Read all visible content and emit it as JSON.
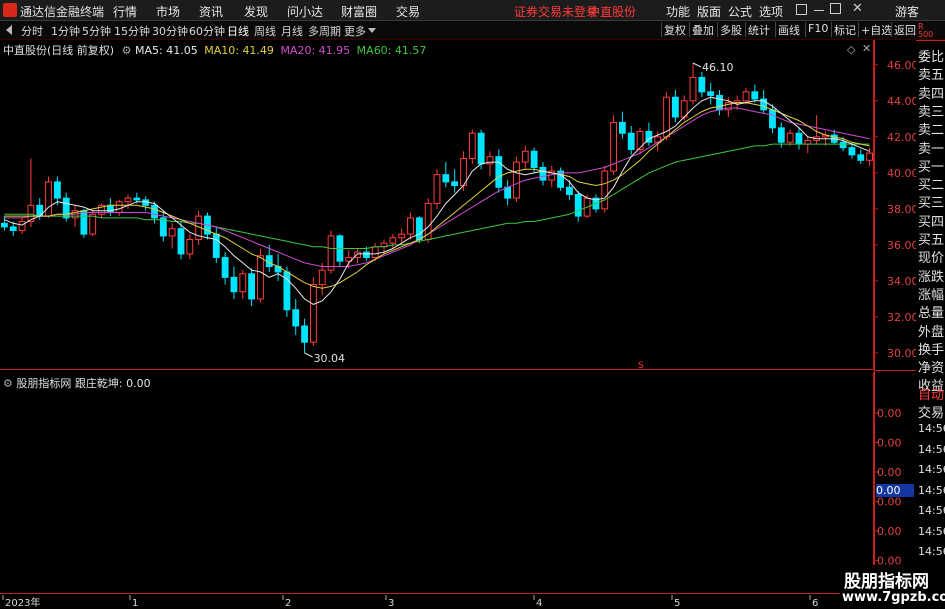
{
  "window": {
    "app_title": "通达信金融终端",
    "menus": [
      "行情",
      "市场",
      "资讯",
      "发现",
      "问小达",
      "财富圈",
      "交易"
    ],
    "status": "证券交易未登录",
    "stock": "中直股份",
    "right_menus": [
      "功能",
      "版面",
      "公式",
      "选项"
    ],
    "guest": "游客"
  },
  "toolbar": {
    "periods": [
      "分时",
      "1分钟",
      "5分钟",
      "15分钟",
      "30分钟",
      "60分钟",
      "日线",
      "周线",
      "月线",
      "多周期",
      "更多"
    ],
    "active_period": "日线",
    "right_buttons": [
      "复权",
      "叠加",
      "多股",
      "统计",
      "画线",
      "F10",
      "标记",
      "+自选",
      "返回"
    ]
  },
  "main_chart": {
    "title": "中直股份(日线 前复权)",
    "ma": [
      {
        "name": "MA5",
        "value": "41.05",
        "color": "#e8e8e8"
      },
      {
        "name": "MA10",
        "value": "41.49",
        "color": "#e0d23c"
      },
      {
        "name": "MA20",
        "value": "41.95",
        "color": "#d14bd1"
      },
      {
        "name": "MA60",
        "value": "41.57",
        "color": "#3cc83c"
      }
    ],
    "high_label": "46.10",
    "low_label": "30.04",
    "marker": "S"
  },
  "sub_chart": {
    "indicator": "股朋指标网",
    "line_name": "跟庄乾坤",
    "line_value": "0.00",
    "current_value": "0.00"
  },
  "side_panel": {
    "header_top": "R",
    "header_bottom": "500",
    "items": [
      "委比",
      "卖五",
      "卖四",
      "卖三",
      "卖二",
      "卖一",
      "买一",
      "买二",
      "买三",
      "买四",
      "买五",
      "现价",
      "涨跌",
      "涨幅",
      "总量",
      "外盘",
      "换手",
      "净资",
      "收益"
    ],
    "auto_label": "自动",
    "trade_label": "交易",
    "times": [
      "14:56",
      "14:56",
      "14:56",
      "14:56",
      "14:56",
      "14:56",
      "14:56",
      "14:56",
      "14:56"
    ]
  },
  "watermark": {
    "line1": "股朋指标网",
    "line2": "www.7gpzb.com"
  },
  "colors": {
    "up": "#ff3c3c",
    "down": "#00e5ff",
    "axis": "#c82020"
  },
  "chart_data": {
    "type": "candlestick",
    "ylim": [
      29.5,
      46.6
    ],
    "yticks": [
      30,
      32,
      34,
      36,
      38,
      40,
      42,
      44,
      46
    ],
    "sub_yticks": [
      "0.00",
      "0.00",
      "0.00",
      "0.00",
      "0.00",
      "0.00",
      "0.00"
    ],
    "x_labels": [
      "2023年",
      "1",
      "2",
      "3",
      "4",
      "5",
      "6"
    ],
    "candles": [
      [
        37.2,
        37.6,
        36.8,
        37.0
      ],
      [
        37.0,
        37.3,
        36.5,
        36.8
      ],
      [
        36.8,
        37.5,
        36.6,
        37.3
      ],
      [
        37.3,
        40.8,
        37.0,
        38.2
      ],
      [
        38.2,
        38.6,
        37.4,
        37.6
      ],
      [
        37.6,
        39.8,
        37.5,
        39.5
      ],
      [
        39.5,
        39.8,
        38.2,
        38.6
      ],
      [
        38.6,
        38.9,
        37.3,
        37.5
      ],
      [
        37.5,
        38.2,
        37.0,
        37.9
      ],
      [
        37.9,
        38.0,
        36.4,
        36.6
      ],
      [
        36.6,
        37.9,
        36.5,
        37.7
      ],
      [
        37.7,
        38.3,
        37.5,
        38.2
      ],
      [
        38.2,
        38.6,
        37.6,
        37.8
      ],
      [
        37.8,
        38.5,
        37.6,
        38.4
      ],
      [
        38.4,
        38.8,
        38.0,
        38.6
      ],
      [
        38.6,
        38.9,
        38.3,
        38.5
      ],
      [
        38.5,
        38.7,
        37.9,
        38.2
      ],
      [
        38.2,
        38.4,
        37.2,
        37.5
      ],
      [
        37.5,
        37.9,
        36.2,
        36.5
      ],
      [
        36.5,
        37.2,
        35.8,
        36.9
      ],
      [
        36.9,
        37.3,
        35.2,
        35.5
      ],
      [
        35.5,
        36.6,
        35.2,
        36.3
      ],
      [
        36.3,
        37.9,
        36.0,
        37.6
      ],
      [
        37.6,
        37.8,
        36.3,
        36.6
      ],
      [
        36.6,
        37.0,
        35.0,
        35.3
      ],
      [
        35.3,
        35.6,
        33.8,
        34.2
      ],
      [
        34.2,
        34.8,
        33.0,
        33.4
      ],
      [
        33.4,
        34.6,
        33.0,
        34.4
      ],
      [
        34.4,
        34.7,
        32.6,
        33.0
      ],
      [
        33.0,
        35.8,
        32.8,
        35.4
      ],
      [
        35.4,
        36.0,
        34.5,
        34.8
      ],
      [
        34.8,
        35.5,
        34.0,
        34.5
      ],
      [
        34.5,
        34.8,
        32.0,
        32.4
      ],
      [
        32.4,
        33.0,
        31.0,
        31.5
      ],
      [
        31.5,
        31.9,
        30.0,
        30.6
      ],
      [
        30.6,
        34.2,
        30.4,
        33.8
      ],
      [
        33.8,
        35.0,
        33.2,
        34.6
      ],
      [
        34.6,
        36.8,
        34.4,
        36.5
      ],
      [
        36.5,
        36.6,
        34.8,
        35.1
      ],
      [
        35.1,
        35.7,
        34.7,
        35.3
      ],
      [
        35.3,
        35.8,
        35.0,
        35.6
      ],
      [
        35.6,
        35.9,
        35.1,
        35.3
      ],
      [
        35.3,
        36.1,
        35.1,
        35.9
      ],
      [
        35.9,
        36.3,
        35.5,
        36.1
      ],
      [
        36.1,
        36.6,
        35.8,
        36.4
      ],
      [
        36.4,
        36.9,
        36.0,
        36.6
      ],
      [
        36.6,
        37.8,
        36.3,
        37.5
      ],
      [
        37.5,
        37.6,
        36.1,
        36.3
      ],
      [
        36.3,
        38.6,
        36.1,
        38.3
      ],
      [
        38.3,
        40.2,
        38.0,
        39.9
      ],
      [
        39.9,
        40.6,
        39.2,
        39.5
      ],
      [
        39.5,
        40.2,
        38.9,
        39.3
      ],
      [
        39.3,
        41.2,
        39.0,
        40.8
      ],
      [
        40.8,
        42.4,
        40.5,
        42.2
      ],
      [
        42.2,
        42.4,
        40.2,
        40.5
      ],
      [
        40.5,
        41.2,
        39.8,
        40.9
      ],
      [
        40.9,
        41.3,
        38.9,
        39.2
      ],
      [
        39.2,
        39.6,
        38.2,
        38.6
      ],
      [
        38.6,
        40.9,
        38.4,
        40.6
      ],
      [
        40.6,
        41.5,
        40.2,
        41.2
      ],
      [
        41.2,
        41.4,
        40.0,
        40.3
      ],
      [
        40.3,
        40.6,
        39.3,
        39.6
      ],
      [
        39.6,
        40.4,
        39.2,
        40.1
      ],
      [
        40.1,
        40.3,
        39.0,
        39.2
      ],
      [
        39.2,
        39.6,
        38.5,
        38.8
      ],
      [
        38.8,
        39.0,
        37.3,
        37.6
      ],
      [
        37.6,
        38.8,
        37.5,
        38.6
      ],
      [
        38.6,
        38.8,
        37.8,
        38.0
      ],
      [
        38.0,
        40.4,
        37.8,
        40.1
      ],
      [
        40.1,
        43.2,
        39.9,
        42.8
      ],
      [
        42.8,
        43.4,
        41.9,
        42.2
      ],
      [
        42.2,
        42.6,
        41.0,
        41.3
      ],
      [
        41.3,
        42.5,
        41.0,
        42.3
      ],
      [
        42.3,
        42.8,
        41.5,
        41.7
      ],
      [
        41.7,
        42.3,
        41.2,
        42.0
      ],
      [
        42.0,
        44.5,
        41.8,
        44.2
      ],
      [
        44.2,
        44.6,
        42.8,
        43.1
      ],
      [
        43.1,
        44.3,
        42.9,
        44.0
      ],
      [
        44.0,
        46.1,
        43.8,
        45.3
      ],
      [
        45.3,
        45.6,
        44.2,
        44.5
      ],
      [
        44.5,
        45.0,
        43.8,
        44.3
      ],
      [
        44.3,
        44.6,
        43.2,
        43.5
      ],
      [
        43.5,
        44.2,
        43.1,
        43.9
      ],
      [
        43.9,
        44.3,
        43.5,
        44.0
      ],
      [
        44.0,
        44.7,
        43.8,
        44.5
      ],
      [
        44.5,
        44.9,
        43.9,
        44.1
      ],
      [
        44.1,
        44.6,
        43.3,
        43.5
      ],
      [
        43.5,
        43.8,
        42.2,
        42.5
      ],
      [
        42.5,
        42.8,
        41.4,
        41.7
      ],
      [
        41.7,
        42.4,
        41.5,
        42.2
      ],
      [
        42.2,
        42.5,
        41.3,
        41.6
      ],
      [
        41.6,
        42.0,
        41.1,
        41.8
      ],
      [
        41.8,
        43.2,
        41.6,
        42.0
      ],
      [
        42.0,
        42.3,
        41.5,
        42.1
      ],
      [
        42.1,
        42.4,
        41.6,
        41.7
      ],
      [
        41.7,
        42.0,
        41.2,
        41.4
      ],
      [
        41.4,
        41.7,
        40.8,
        41.0
      ],
      [
        41.0,
        41.3,
        40.5,
        40.7
      ],
      [
        40.7,
        41.4,
        40.4,
        41.1
      ]
    ],
    "ma5": [
      37.4,
      37.2,
      37.1,
      37.4,
      37.6,
      38.1,
      38.4,
      38.3,
      38.2,
      38.1,
      37.9,
      37.9,
      37.9,
      38.0,
      38.2,
      38.4,
      38.4,
      38.3,
      37.9,
      37.5,
      37.1,
      36.7,
      36.5,
      36.4,
      36.3,
      35.9,
      35.4,
      35.0,
      34.6,
      34.5,
      34.2,
      34.4,
      34.1,
      33.6,
      33.0,
      32.7,
      32.9,
      33.4,
      34.1,
      35.0,
      35.5,
      35.5,
      35.5,
      35.6,
      35.8,
      36.1,
      36.4,
      36.6,
      37.0,
      37.6,
      38.3,
      38.8,
      39.3,
      40.1,
      40.5,
      40.6,
      40.6,
      40.2,
      40.0,
      39.9,
      40.0,
      40.1,
      40.0,
      39.9,
      39.5,
      38.9,
      38.6,
      38.5,
      38.6,
      39.2,
      40.1,
      40.9,
      41.4,
      41.9,
      42.1,
      42.3,
      42.6,
      43.1,
      43.6,
      44.0,
      44.2,
      44.1,
      44.0,
      43.8,
      43.9,
      44.0,
      44.0,
      43.7,
      43.3,
      42.9,
      42.5,
      42.0,
      41.9,
      41.9,
      41.9,
      41.8,
      41.6,
      41.4,
      41.2
    ],
    "ma10": [
      37.6,
      37.6,
      37.6,
      37.6,
      37.6,
      37.6,
      37.7,
      37.7,
      37.8,
      37.9,
      38.0,
      38.1,
      38.2,
      38.2,
      38.2,
      38.2,
      38.1,
      38.0,
      37.8,
      37.6,
      37.4,
      37.2,
      37.0,
      36.8,
      36.6,
      36.4,
      36.1,
      35.8,
      35.5,
      35.3,
      35.0,
      34.8,
      34.5,
      34.2,
      33.9,
      33.7,
      33.6,
      33.7,
      33.9,
      34.2,
      34.5,
      34.9,
      35.2,
      35.5,
      35.7,
      35.9,
      36.1,
      36.3,
      36.6,
      37.0,
      37.4,
      37.8,
      38.2,
      38.6,
      39.0,
      39.4,
      39.8,
      40.0,
      40.1,
      40.2,
      40.2,
      40.1,
      40.0,
      39.9,
      39.8,
      39.5,
      39.4,
      39.3,
      39.4,
      39.6,
      39.9,
      40.3,
      40.7,
      41.2,
      41.6,
      42.0,
      42.4,
      42.8,
      43.1,
      43.4,
      43.6,
      43.7,
      43.8,
      43.9,
      43.9,
      43.8,
      43.7,
      43.5,
      43.3,
      43.1,
      42.9,
      42.6,
      42.3,
      42.1,
      42.0,
      41.9,
      41.7,
      41.6,
      41.5
    ],
    "ma20": [
      37.5,
      37.5,
      37.5,
      37.6,
      37.6,
      37.6,
      37.7,
      37.7,
      37.7,
      37.8,
      37.8,
      37.8,
      37.8,
      37.8,
      37.8,
      37.8,
      37.8,
      37.7,
      37.6,
      37.5,
      37.4,
      37.3,
      37.2,
      37.1,
      37.0,
      36.8,
      36.6,
      36.4,
      36.2,
      36.0,
      35.8,
      35.6,
      35.4,
      35.2,
      35.0,
      34.9,
      34.8,
      34.8,
      34.8,
      34.8,
      34.9,
      35.0,
      35.2,
      35.4,
      35.6,
      35.8,
      36.0,
      36.3,
      36.6,
      36.9,
      37.2,
      37.5,
      37.8,
      38.1,
      38.4,
      38.7,
      39.0,
      39.2,
      39.4,
      39.6,
      39.7,
      39.8,
      39.9,
      40.0,
      40.0,
      40.0,
      40.1,
      40.2,
      40.3,
      40.5,
      40.7,
      40.9,
      41.1,
      41.4,
      41.7,
      42.0,
      42.3,
      42.6,
      42.9,
      43.2,
      43.4,
      43.5,
      43.6,
      43.6,
      43.5,
      43.4,
      43.3,
      43.2,
      43.0,
      42.8,
      42.7,
      42.6,
      42.5,
      42.4,
      42.3,
      42.2,
      42.1,
      42.0,
      41.9
    ],
    "ma60": [
      37.7,
      37.7,
      37.7,
      37.7,
      37.6,
      37.6,
      37.6,
      37.6,
      37.6,
      37.6,
      37.6,
      37.5,
      37.5,
      37.5,
      37.5,
      37.5,
      37.4,
      37.4,
      37.4,
      37.3,
      37.3,
      37.2,
      37.2,
      37.1,
      37.0,
      36.9,
      36.8,
      36.7,
      36.6,
      36.5,
      36.4,
      36.3,
      36.2,
      36.1,
      36.0,
      35.9,
      35.9,
      35.8,
      35.8,
      35.8,
      35.8,
      35.8,
      35.9,
      35.9,
      36.0,
      36.0,
      36.1,
      36.2,
      36.3,
      36.4,
      36.5,
      36.6,
      36.7,
      36.8,
      36.9,
      37.0,
      37.1,
      37.2,
      37.2,
      37.3,
      37.3,
      37.4,
      37.5,
      37.6,
      37.7,
      37.9,
      38.1,
      38.3,
      38.5,
      38.8,
      39.1,
      39.4,
      39.7,
      40.0,
      40.2,
      40.4,
      40.6,
      40.7,
      40.8,
      40.9,
      41.0,
      41.1,
      41.2,
      41.3,
      41.4,
      41.5,
      41.5,
      41.6,
      41.6,
      41.6,
      41.6,
      41.6,
      41.6,
      41.6,
      41.6,
      41.6,
      41.6,
      41.6,
      41.6
    ]
  }
}
